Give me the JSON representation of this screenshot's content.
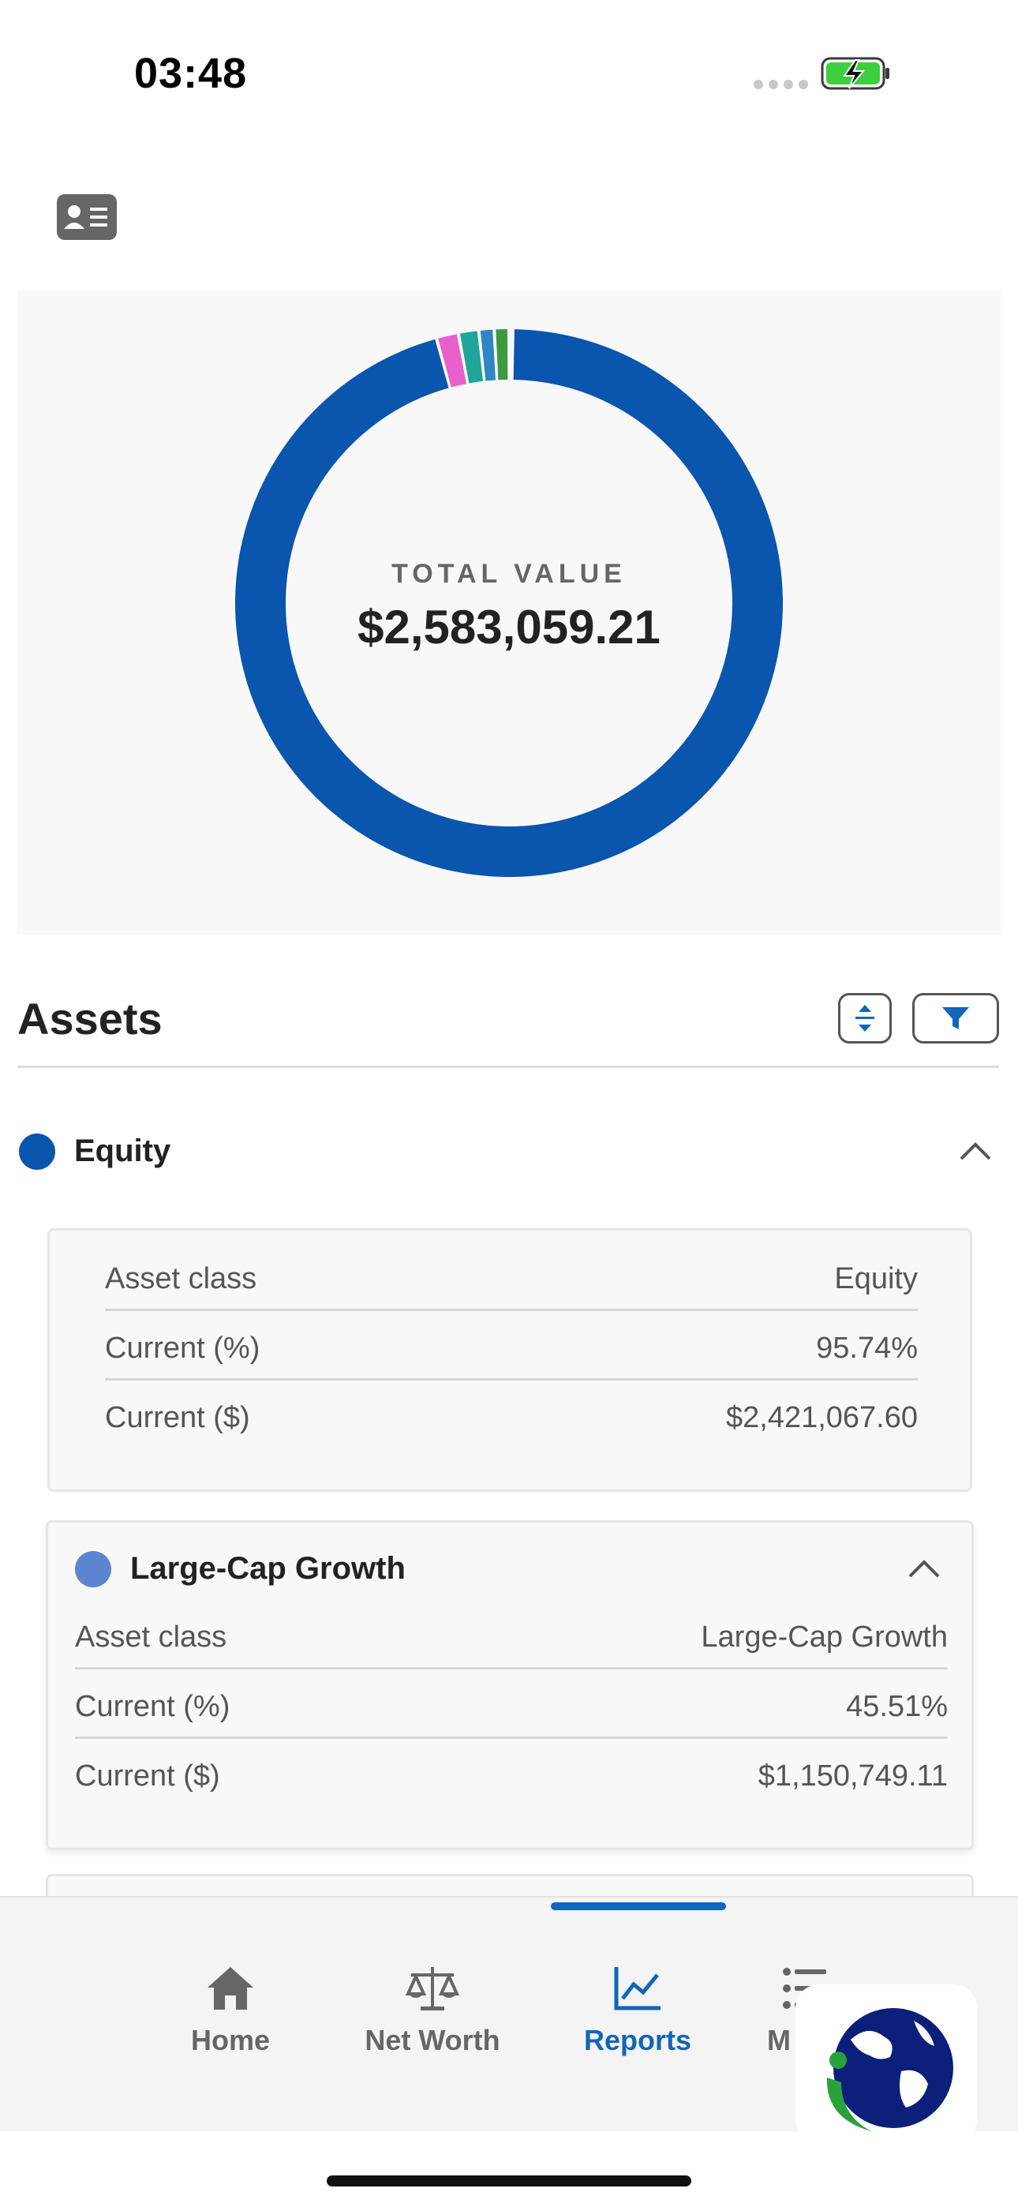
{
  "status": {
    "time": "03:48"
  },
  "header": {
    "profile_icon": "contact-card-icon"
  },
  "chart_data": {
    "type": "pie",
    "subtype": "donut",
    "center_label": "TOTAL VALUE",
    "center_value": "$2,583,059.21",
    "slices": [
      {
        "value": 95.74,
        "color": "#0a55ad"
      },
      {
        "value": 1.3,
        "color": "#e85fce"
      },
      {
        "value": 1.2,
        "color": "#1fa59a"
      },
      {
        "value": 0.9,
        "color": "#2f86c4"
      },
      {
        "value": 0.86,
        "color": "#3d9a3f"
      }
    ]
  },
  "assets": {
    "title": "Assets",
    "expand_icon": "expand-collapse-icon",
    "filter_icon": "filter-icon",
    "group": {
      "name": "Equity",
      "color": "#0a55ad",
      "rows": [
        {
          "key": "Asset class",
          "value": "Equity"
        },
        {
          "key": "Current (%)",
          "value": "95.74%"
        },
        {
          "key": "Current ($)",
          "value": "$2,421,067.60"
        }
      ]
    },
    "subgroup": {
      "name": "Large-Cap Growth",
      "color": "#5b85cf",
      "rows": [
        {
          "key": "Asset class",
          "value": "Large-Cap Growth"
        },
        {
          "key": "Current (%)",
          "value": "45.51%"
        },
        {
          "key": "Current ($)",
          "value": "$1,150,749.11"
        }
      ]
    }
  },
  "tabs": [
    {
      "label": "Home",
      "icon": "home-icon"
    },
    {
      "label": "Net Worth",
      "icon": "scale-icon"
    },
    {
      "label": "Reports",
      "icon": "chart-line-icon",
      "active": true
    },
    {
      "label": "M",
      "icon": "list-icon"
    }
  ],
  "colors": {
    "accent": "#1066b8",
    "donut_primary": "#0a55ad"
  }
}
